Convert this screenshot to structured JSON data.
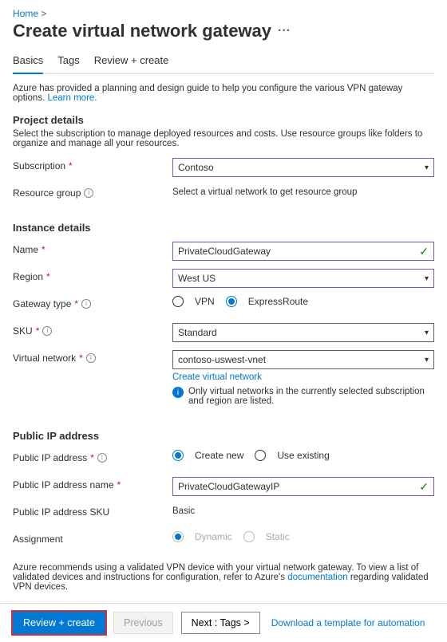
{
  "breadcrumb": {
    "home": "Home"
  },
  "page": {
    "title": "Create virtual network gateway",
    "intro_pre": "Azure has provided a planning and design guide to help you configure the various VPN gateway options.  ",
    "learn_more": "Learn more."
  },
  "tabs": {
    "basics": "Basics",
    "tags": "Tags",
    "review": "Review + create"
  },
  "project": {
    "heading": "Project details",
    "desc": "Select the subscription to manage deployed resources and costs. Use resource groups like folders to organize and manage all your resources.",
    "subscription_label": "Subscription",
    "subscription_value": "Contoso",
    "rg_label": "Resource group",
    "rg_msg": "Select a virtual network to get resource group"
  },
  "instance": {
    "heading": "Instance details",
    "name_label": "Name",
    "name_value": "PrivateCloudGateway",
    "region_label": "Region",
    "region_value": "West US",
    "gwtype_label": "Gateway type",
    "gwtype_vpn": "VPN",
    "gwtype_er": "ExpressRoute",
    "sku_label": "SKU",
    "sku_value": "Standard",
    "vnet_label": "Virtual network",
    "vnet_value": "contoso-uswest-vnet",
    "create_vnet": "Create virtual network",
    "vnet_info": "Only virtual networks in the currently selected subscription and region are listed."
  },
  "pip": {
    "heading": "Public IP address",
    "addr_label": "Public IP address",
    "create_new": "Create new",
    "use_existing": "Use existing",
    "name_label": "Public IP address name",
    "name_value": "PrivateCloudGatewayIP",
    "sku_label": "Public IP address SKU",
    "sku_value": "Basic",
    "assign_label": "Assignment",
    "dynamic": "Dynamic",
    "static": "Static"
  },
  "recommend": {
    "pre": "Azure recommends using a validated VPN device with your virtual network gateway. To view a list of validated devices and instructions for configuration, refer to Azure's ",
    "doclink": "documentation",
    "post": " regarding validated VPN devices."
  },
  "footer": {
    "review": "Review + create",
    "previous": "Previous",
    "next": "Next : Tags >",
    "download": "Download a template for automation"
  }
}
